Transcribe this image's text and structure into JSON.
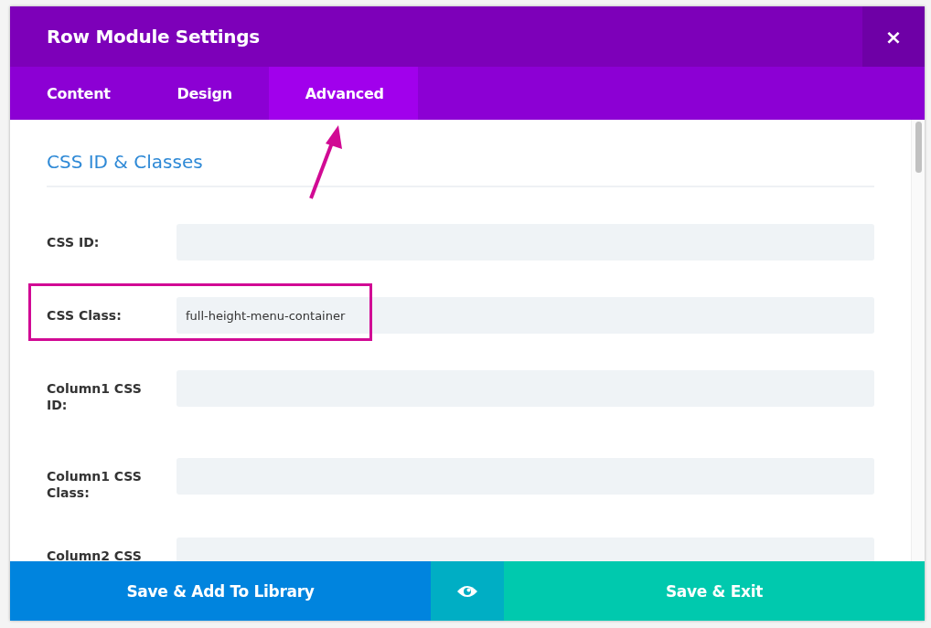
{
  "window": {
    "title": "Row Module Settings",
    "close": "×"
  },
  "tabs": [
    {
      "label": "Content",
      "selected": false,
      "annotated": false
    },
    {
      "label": "Design",
      "selected": false,
      "annotated": false
    },
    {
      "label": "Advanced",
      "selected": true,
      "annotated": true
    }
  ],
  "section": {
    "title": "CSS ID & Classes"
  },
  "fields": [
    {
      "label": "CSS ID:",
      "highlighted": false
    },
    {
      "label": "CSS Class:",
      "value": "full-height-menu-container",
      "highlighted": true
    },
    {
      "label": "Column1 CSS ID:",
      "highlighted": false
    },
    {
      "label": "Column1 CSS Class:",
      "highlighted": false
    },
    {
      "label": "Column2 CSS",
      "highlighted": false
    }
  ],
  "footer": {
    "library_button": "Save & Add To Library",
    "exit_button": "Save & Exit"
  }
}
